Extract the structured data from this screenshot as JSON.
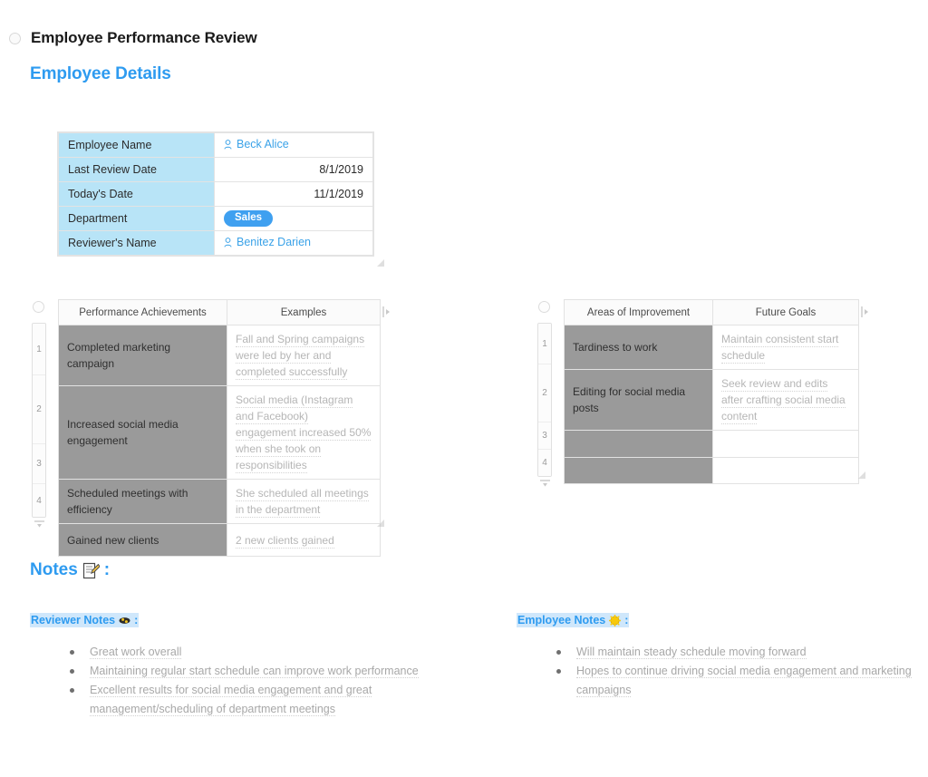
{
  "document": {
    "title": "Employee Performance Review",
    "section_heading": "Employee Details",
    "notes_heading": "Notes",
    "notes_heading_suffix": ":",
    "notes_icon": "memo-icon"
  },
  "colors": {
    "accent_blue": "#2e9bf0",
    "label_cell_blue": "#b8e4f7",
    "tag_blue": "#3fa0f0",
    "filled_cell_gray": "#9a9a9a",
    "note_text_gray": "#b6b6b6",
    "highlight_blue": "#cfe7fb"
  },
  "details": {
    "rows": [
      {
        "label": "Employee Name",
        "value": "Beck Alice",
        "type": "person"
      },
      {
        "label": "Last Review Date",
        "value": "8/1/2019",
        "type": "date"
      },
      {
        "label": "Today's Date",
        "value": "11/1/2019",
        "type": "date"
      },
      {
        "label": "Department",
        "value": "Sales",
        "type": "tag"
      },
      {
        "label": "Reviewer's Name",
        "value": "Benitez Darien",
        "type": "person"
      }
    ]
  },
  "performance_table": {
    "columns": [
      "Performance Achievements",
      "Examples"
    ],
    "row_numbers": [
      "1",
      "2",
      "3",
      "4"
    ],
    "rows": [
      {
        "achievement": "Completed marketing campaign",
        "example": "Fall and Spring campaigns were led by her and completed successfully"
      },
      {
        "achievement": "Increased social media engagement",
        "example": "Social media (Instagram and Facebook) engagement increased 50% when she took on responsibilities"
      },
      {
        "achievement": "Scheduled meetings with efficiency",
        "example": "She scheduled all meetings in the department"
      },
      {
        "achievement": "Gained new clients",
        "example": "2 new clients gained"
      }
    ]
  },
  "improvement_table": {
    "columns": [
      "Areas of Improvement",
      "Future Goals"
    ],
    "row_numbers": [
      "1",
      "2",
      "3",
      "4"
    ],
    "rows": [
      {
        "area": "Tardiness to work",
        "goal": "Maintain consistent start schedule"
      },
      {
        "area": "Editing for social media posts",
        "goal": "Seek review and edits after crafting social media content"
      },
      {
        "area": "",
        "goal": ""
      },
      {
        "area": "",
        "goal": ""
      }
    ]
  },
  "reviewer_notes": {
    "heading": "Reviewer Notes",
    "heading_suffix": ":",
    "icon": "eye-icon",
    "items": [
      "Great work overall",
      "Maintaining regular start schedule can improve work performance",
      "Excellent results for social media engagement and great management/scheduling of department meetings"
    ]
  },
  "employee_notes": {
    "heading": "Employee Notes",
    "heading_suffix": ":",
    "icon": "sun-icon",
    "items": [
      "Will maintain steady schedule moving forward",
      "Hopes to continue driving social media engagement and marketing campaigns"
    ]
  }
}
